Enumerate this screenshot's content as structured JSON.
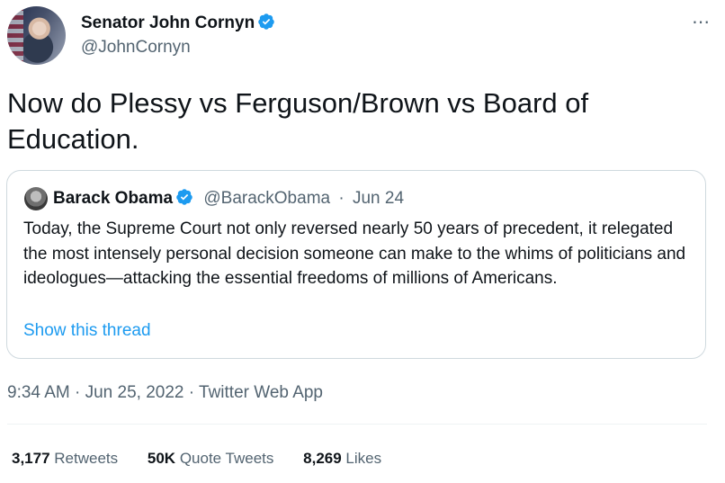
{
  "tweet": {
    "author_name": "Senator John Cornyn",
    "author_handle": "@JohnCornyn",
    "text": "Now do Plessy vs Ferguson/Brown vs Board of Education.",
    "more_icon": "⋯",
    "timestamp": "9:34 AM · Jun 25, 2022 · Twitter Web App",
    "verified_color": "#1d9bf0"
  },
  "quote": {
    "author_name": "Barack Obama",
    "author_handle": "@BarackObama",
    "separator": "·",
    "date": "Jun 24",
    "text": "Today, the Supreme Court not only reversed nearly 50 years of precedent, it relegated the most intensely personal decision someone can make to the whims of politicians and ideologues—attacking the essential freedoms of millions of Americans.",
    "show_thread": "Show this thread"
  },
  "stats": [
    {
      "count": "3,177",
      "label": "Retweets"
    },
    {
      "count": "50K",
      "label": "Quote Tweets"
    },
    {
      "count": "8,269",
      "label": "Likes"
    }
  ],
  "colors": {
    "link": "#1d9bf0",
    "secondary_text": "#536471",
    "primary_text": "#0f1419",
    "border": "#cfd9de"
  }
}
